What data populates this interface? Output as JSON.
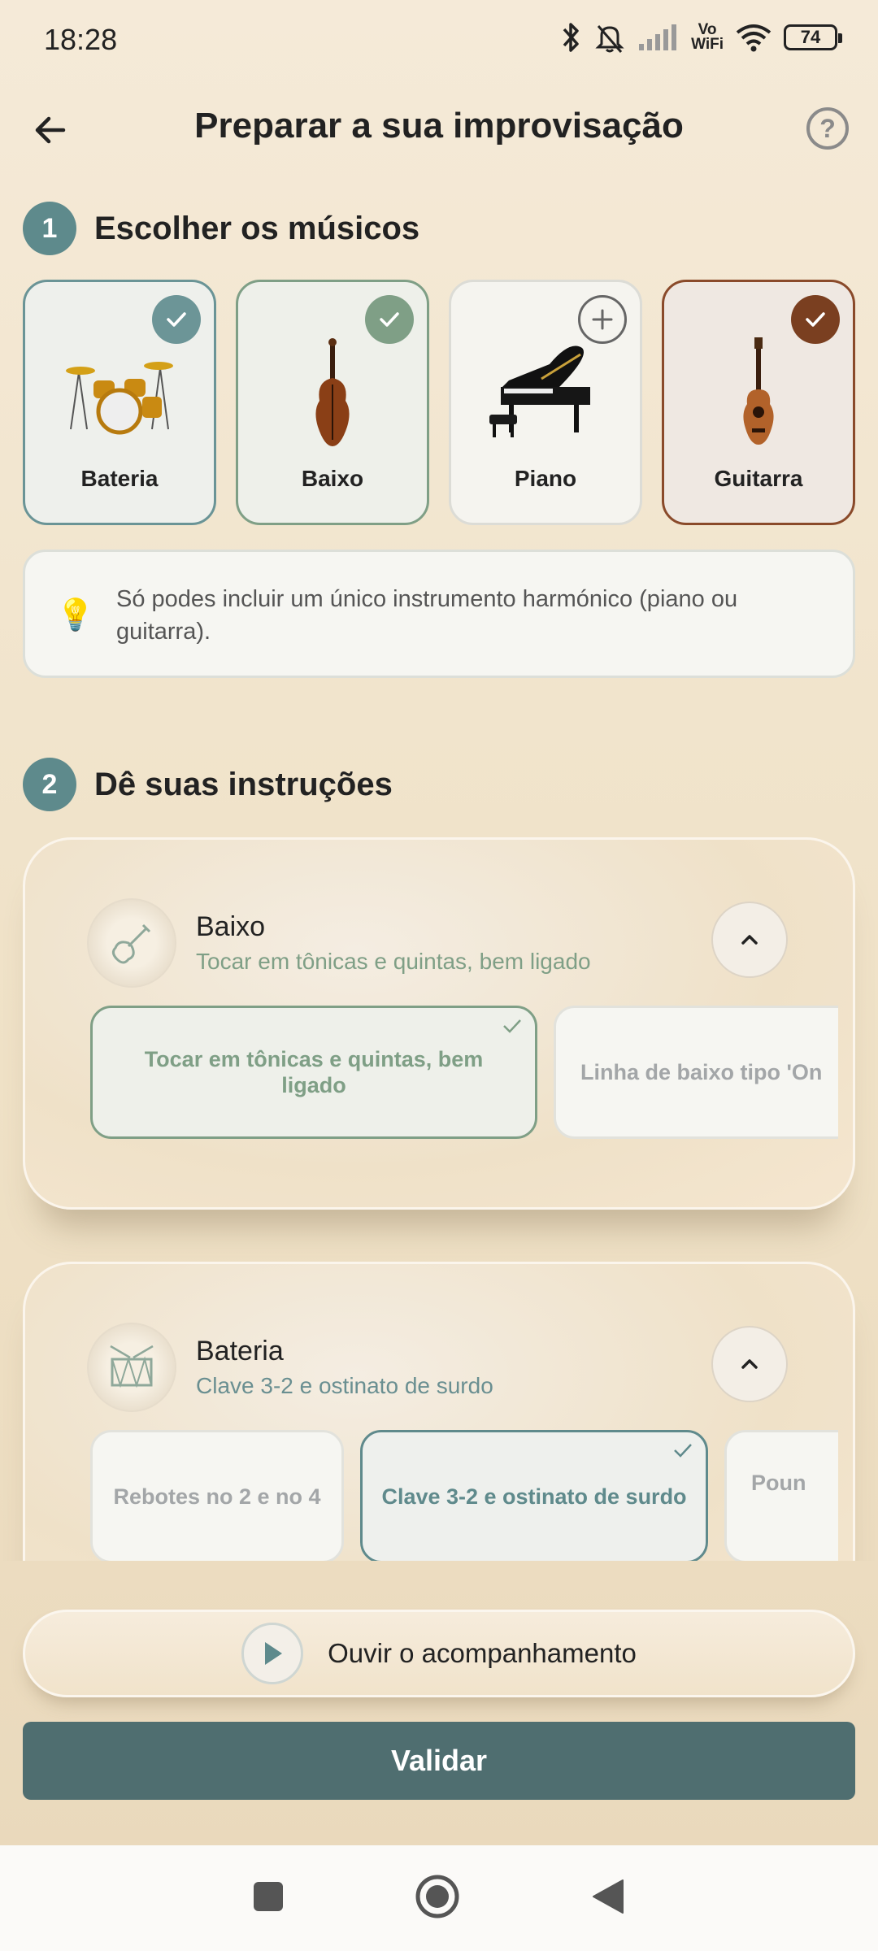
{
  "status_bar": {
    "time": "18:28",
    "battery": "74",
    "vowifi_top": "Vo",
    "vowifi_bottom": "WiFi"
  },
  "header": {
    "title": "Preparar a sua improvisação",
    "back_icon": "arrow-left-icon",
    "help_label": "?"
  },
  "section1": {
    "number": "1",
    "title": "Escolher os músicos"
  },
  "musicians": [
    {
      "label": "Bateria",
      "selected": true,
      "accent": "#6c9597"
    },
    {
      "label": "Baixo",
      "selected": true,
      "accent": "#7f9f86"
    },
    {
      "label": "Piano",
      "selected": false,
      "accent": "#666666"
    },
    {
      "label": "Guitarra",
      "selected": true,
      "accent": "#7a3f20"
    }
  ],
  "info": {
    "icon": "💡",
    "text": "Só podes incluir um único instrumento harmónico (piano ou guitarra)."
  },
  "section2": {
    "number": "2",
    "title": "Dê suas instruções"
  },
  "instructions": [
    {
      "name": "Baixo",
      "subtitle": "Tocar em tônicas e quintas, bem ligado",
      "options": [
        "Tocar em tônicas e quintas, bem ligado",
        "Linha de baixo tipo 'On"
      ]
    },
    {
      "name": "Bateria",
      "subtitle": "Clave 3-2 e ostinato de surdo",
      "options": [
        "Rebotes no 2 e no 4",
        "Clave 3-2 e ostinato de surdo",
        "Poun"
      ]
    }
  ],
  "listen": {
    "label": "Ouvir o acompanhamento"
  },
  "validate": {
    "label": "Validar"
  },
  "colors": {
    "teal": "#5e8a8c",
    "green": "#7f9f86",
    "brown": "#7a3f20",
    "button": "#4f6e70"
  }
}
